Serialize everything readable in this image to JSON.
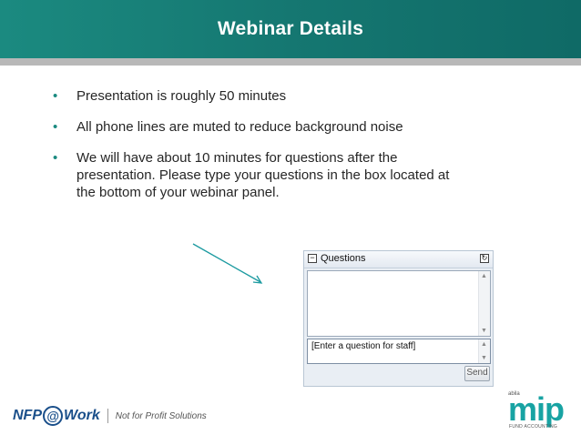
{
  "slide": {
    "title": "Webinar Details",
    "bullets": [
      "Presentation is roughly 50 minutes",
      "All phone lines are muted to reduce background noise",
      "We will have about 10 minutes for questions after the presentation. Please type your questions in the box located at the bottom of your webinar panel."
    ],
    "bullet_glyph": "•"
  },
  "questions_panel": {
    "title": "Questions",
    "collapse_glyph": "−",
    "popout_glyph": "↻",
    "input_placeholder": "[Enter a question for staff]",
    "send_label": "Send"
  },
  "footer": {
    "nfp": "NFP",
    "at": "@",
    "work": "Work",
    "tagline": "Not for Profit Solutions",
    "abila": "abila",
    "mip": "mip",
    "mip_sub": "FUND ACCOUNTING"
  },
  "colors": {
    "header": "#157771",
    "accent": "#1b8a80",
    "arrow": "#1b9aa0",
    "nfp_blue": "#1a4f8a",
    "mip_teal": "#18a3a3"
  },
  "icons": {
    "collapse": "minus-box-icon",
    "popout": "popout-icon",
    "scroll_up": "scroll-up-icon",
    "scroll_down": "scroll-down-icon",
    "arrow": "pointer-arrow-icon"
  }
}
